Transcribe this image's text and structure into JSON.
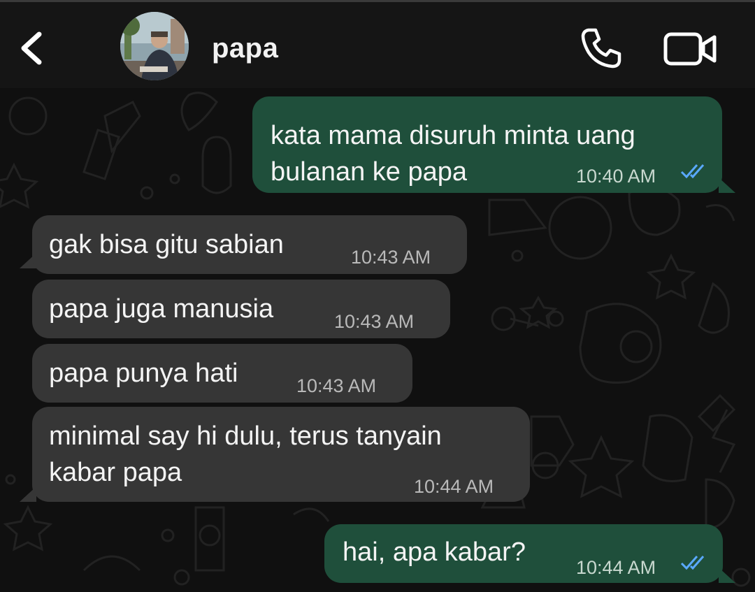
{
  "header": {
    "contact_name": "papa",
    "icons": {
      "back": "chevron-left-icon",
      "call": "phone-icon",
      "video": "video-camera-icon"
    }
  },
  "colors": {
    "header_bg": "#151515",
    "outgoing_bubble": "#1f4f3b",
    "incoming_bubble": "#363636",
    "read_ticks": "#5aa9ff"
  },
  "messages": [
    {
      "direction": "out",
      "text": "kata mama disuruh minta uang\nbulanan ke papa",
      "time": "10:40 AM",
      "status": "read"
    },
    {
      "direction": "in",
      "text": "gak bisa gitu sabian",
      "time": "10:43 AM"
    },
    {
      "direction": "in",
      "text": "papa juga manusia",
      "time": "10:43 AM"
    },
    {
      "direction": "in",
      "text": "papa punya hati",
      "time": "10:43 AM"
    },
    {
      "direction": "in",
      "text": "minimal say hi dulu, terus tanyain\nkabar papa",
      "time": "10:44 AM"
    },
    {
      "direction": "out",
      "text": "hai, apa kabar?",
      "time": "10:44 AM",
      "status": "read"
    }
  ]
}
